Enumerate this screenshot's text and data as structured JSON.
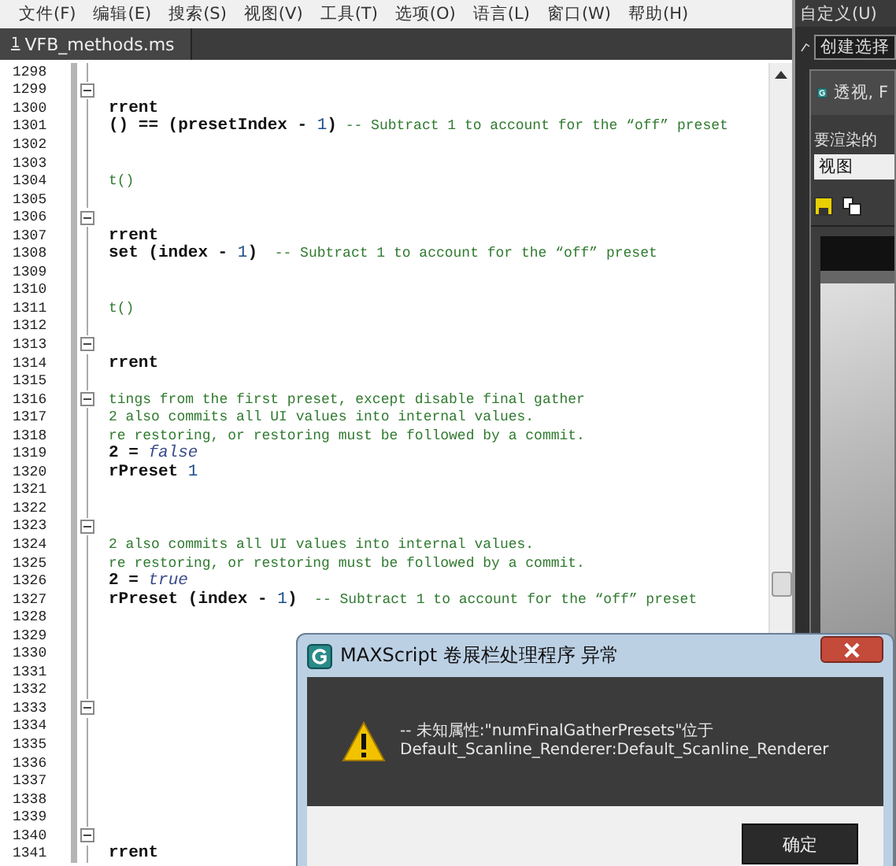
{
  "menu_bar": [
    "文件(F)",
    "编辑(E)",
    "搜索(S)",
    "视图(V)",
    "工具(T)",
    "选项(O)",
    "语言(L)",
    "窗口(W)",
    "帮助(H)"
  ],
  "tabs": [
    {
      "number": "1",
      "label": "VFB_methods.ms",
      "selected": true
    }
  ],
  "editor": {
    "lines": [
      {
        "number": "1298",
        "fold": false
      },
      {
        "number": "1299",
        "fold": true
      },
      {
        "number": "1300",
        "fold": false,
        "segments": [
          {
            "kind": "code",
            "text": "rrent"
          }
        ]
      },
      {
        "number": "1301",
        "fold": false,
        "segments": [
          {
            "kind": "code",
            "text": "() == (presetIndex - "
          },
          {
            "kind": "number",
            "text": "1"
          },
          {
            "kind": "code",
            "text": ")"
          },
          {
            "kind": "comment",
            "text": " -- Subtract 1 to account for the “off” preset"
          }
        ]
      },
      {
        "number": "1302",
        "fold": false
      },
      {
        "number": "1303",
        "fold": false
      },
      {
        "number": "1304",
        "fold": false,
        "segments": [
          {
            "kind": "comment",
            "text": "t()"
          }
        ]
      },
      {
        "number": "1305",
        "fold": false
      },
      {
        "number": "1306",
        "fold": true
      },
      {
        "number": "1307",
        "fold": false,
        "segments": [
          {
            "kind": "code",
            "text": "rrent"
          }
        ]
      },
      {
        "number": "1308",
        "fold": false,
        "segments": [
          {
            "kind": "code",
            "text": "set (index - "
          },
          {
            "kind": "number",
            "text": "1"
          },
          {
            "kind": "code",
            "text": ")"
          },
          {
            "kind": "comment",
            "text": "  -- Subtract 1 to account for the “off” preset"
          }
        ]
      },
      {
        "number": "1309",
        "fold": false
      },
      {
        "number": "1310",
        "fold": false
      },
      {
        "number": "1311",
        "fold": false,
        "segments": [
          {
            "kind": "comment",
            "text": "t()"
          }
        ]
      },
      {
        "number": "1312",
        "fold": false
      },
      {
        "number": "1313",
        "fold": true
      },
      {
        "number": "1314",
        "fold": false,
        "segments": [
          {
            "kind": "code",
            "text": "rrent"
          }
        ]
      },
      {
        "number": "1315",
        "fold": false
      },
      {
        "number": "1316",
        "fold": true,
        "segments": [
          {
            "kind": "comment",
            "text": "tings from the first preset, except disable final gather"
          }
        ]
      },
      {
        "number": "1317",
        "fold": false,
        "segments": [
          {
            "kind": "comment",
            "text": "2 also commits all UI values into internal values."
          }
        ]
      },
      {
        "number": "1318",
        "fold": false,
        "segments": [
          {
            "kind": "comment",
            "text": "re restoring, or restoring must be followed by a commit."
          }
        ]
      },
      {
        "number": "1319",
        "fold": false,
        "segments": [
          {
            "kind": "code",
            "text": "2 = "
          },
          {
            "kind": "keyword",
            "text": "false"
          }
        ]
      },
      {
        "number": "1320",
        "fold": false,
        "segments": [
          {
            "kind": "code",
            "text": "rPreset "
          },
          {
            "kind": "number",
            "text": "1"
          }
        ]
      },
      {
        "number": "1321",
        "fold": false
      },
      {
        "number": "1322",
        "fold": false
      },
      {
        "number": "1323",
        "fold": true
      },
      {
        "number": "1324",
        "fold": false,
        "segments": [
          {
            "kind": "comment",
            "text": "2 also commits all UI values into internal values."
          }
        ]
      },
      {
        "number": "1325",
        "fold": false,
        "segments": [
          {
            "kind": "comment",
            "text": "re restoring, or restoring must be followed by a commit."
          }
        ]
      },
      {
        "number": "1326",
        "fold": false,
        "segments": [
          {
            "kind": "code",
            "text": "2 = "
          },
          {
            "kind": "keyword",
            "text": "true"
          }
        ]
      },
      {
        "number": "1327",
        "fold": false,
        "segments": [
          {
            "kind": "code",
            "text": "rPreset (index - "
          },
          {
            "kind": "number",
            "text": "1"
          },
          {
            "kind": "code",
            "text": ")"
          },
          {
            "kind": "comment",
            "text": "  -- Subtract 1 to account for the “off” preset"
          }
        ]
      },
      {
        "number": "1328",
        "fold": false
      },
      {
        "number": "1329",
        "fold": false
      },
      {
        "number": "1330",
        "fold": false
      },
      {
        "number": "1331",
        "fold": false
      },
      {
        "number": "1332",
        "fold": false
      },
      {
        "number": "1333",
        "fold": true
      },
      {
        "number": "1334",
        "fold": false
      },
      {
        "number": "1335",
        "fold": false
      },
      {
        "number": "1336",
        "fold": false
      },
      {
        "number": "1337",
        "fold": false
      },
      {
        "number": "1338",
        "fold": false
      },
      {
        "number": "1339",
        "fold": false
      },
      {
        "number": "1340",
        "fold": true
      },
      {
        "number": "1341",
        "fold": false,
        "segments": [
          {
            "kind": "code",
            "text": "rrent"
          }
        ]
      }
    ]
  },
  "side_panel": {
    "menu": "自定义(U)",
    "selection_field": "创建选择",
    "viewport_tab": "透视, F",
    "render_label": "要渲染的",
    "render_dropdown": "视图"
  },
  "dialog": {
    "title": "MAXScript 卷展栏处理程序 异常",
    "message_lines": [
      "-- 未知属性:\"numFinalGatherPresets\"位于",
      "Default_Scanline_Renderer:Default_Scanline_Renderer"
    ],
    "button": "确定"
  }
}
